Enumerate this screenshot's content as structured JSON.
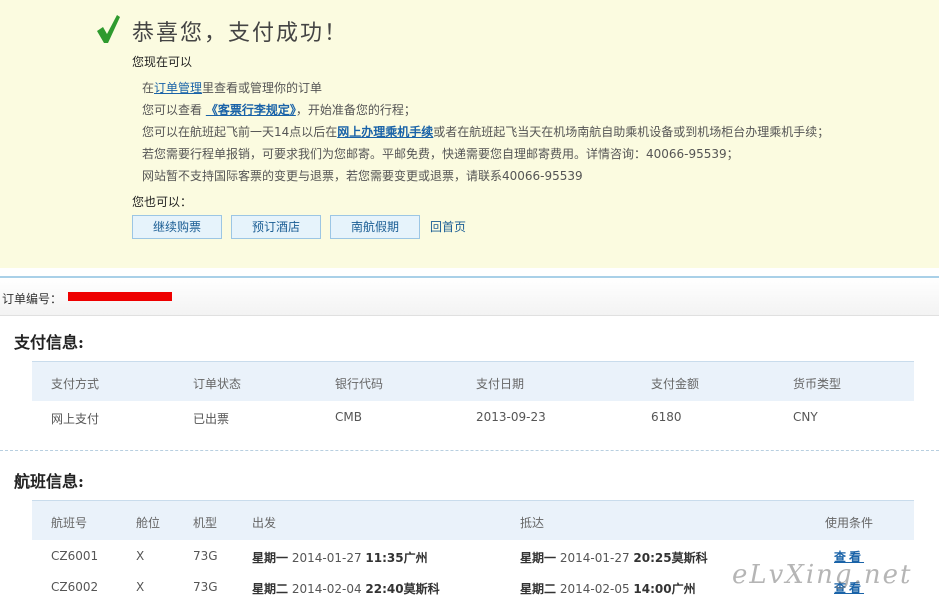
{
  "success": {
    "title": "恭喜您，支付成功！",
    "can_do_heading": "您现在可以",
    "lines": [
      {
        "pre": "在",
        "link": "订单管理",
        "post": "里查看或管理你的订单"
      },
      {
        "pre": "您可以查看 ",
        "link": "《客票行李规定》",
        "post": "，开始准备您的行程；"
      },
      {
        "pre": "您可以在航班起飞前一天14点以后在",
        "link": "网上办理乘机手续",
        "post": "或者在航班起飞当天在机场南航自助乘机设备或到机场柜台办理乘机手续；"
      },
      {
        "text": "若您需要行程单报销，可要求我们为您邮寄。平邮免费，快递需要您自理邮寄费用。详情咨询：40066-95539；"
      },
      {
        "text": "网站暂不支持国际客票的变更与退票，若您需要变更或退票，请联系40066-95539"
      }
    ],
    "also_heading": "您也可以：",
    "buttons": [
      "继续购票",
      "预订酒店",
      "南航假期"
    ],
    "home_link": "回首页"
  },
  "order": {
    "label": "订单编号："
  },
  "payment": {
    "title": "支付信息:",
    "headers": [
      "支付方式",
      "订单状态",
      "银行代码",
      "支付日期",
      "支付金额",
      "货币类型"
    ],
    "row": [
      "网上支付",
      "已出票",
      "CMB",
      "2013-09-23",
      "6180",
      "CNY"
    ]
  },
  "flights": {
    "title": "航班信息:",
    "headers": [
      "航班号",
      "舱位",
      "机型",
      "出发",
      "抵达",
      "使用条件"
    ],
    "rows": [
      {
        "flight": "CZ6001",
        "cabin": "X",
        "model": "73G",
        "dep_day": "星期一",
        "dep_date": "2014-01-27",
        "dep_time_city": "11:35广州",
        "arr_day": "星期一",
        "arr_date": "2014-01-27",
        "arr_time_city": "20:25莫斯科",
        "view": "查看"
      },
      {
        "flight": "CZ6002",
        "cabin": "X",
        "model": "73G",
        "dep_day": "星期二",
        "dep_date": "2014-02-04",
        "dep_time_city": "22:40莫斯科",
        "arr_day": "星期二",
        "arr_date": "2014-02-05",
        "arr_time_city": "14:00广州",
        "view": "查看"
      }
    ]
  },
  "watermark": "eLvXing.net",
  "colors": {
    "panel_bg": "#fbfbe0",
    "check": "#2e9a2e",
    "link": "#1a63a8",
    "table_head_bg": "#eaf2fa",
    "redaction": "#ee0000"
  }
}
